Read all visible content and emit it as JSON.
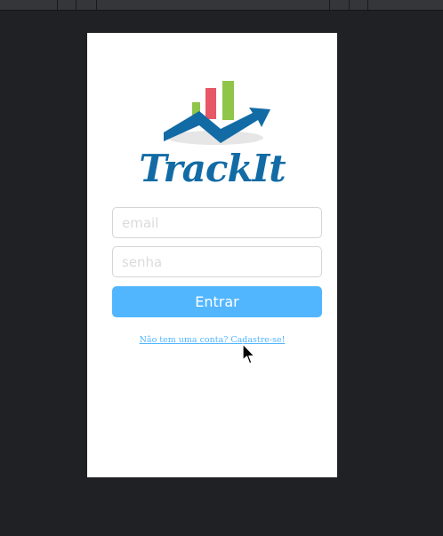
{
  "app": {
    "brand_name": "TrackIt"
  },
  "login": {
    "email_placeholder": "email",
    "password_placeholder": "senha",
    "submit_label": "Entrar",
    "signup_link": "Não tem uma conta? Cadastre-se!"
  },
  "colors": {
    "accent": "#52b6ff",
    "brand_blue": "#126ba5",
    "bar_pink": "#e75766",
    "bar_green": "#8fc549",
    "shadow_gray": "#e6e6e6",
    "page_background": "#202124"
  },
  "icons": {
    "logo": "trending-bar-chart-logo",
    "cursor": "mouse-pointer-icon"
  }
}
